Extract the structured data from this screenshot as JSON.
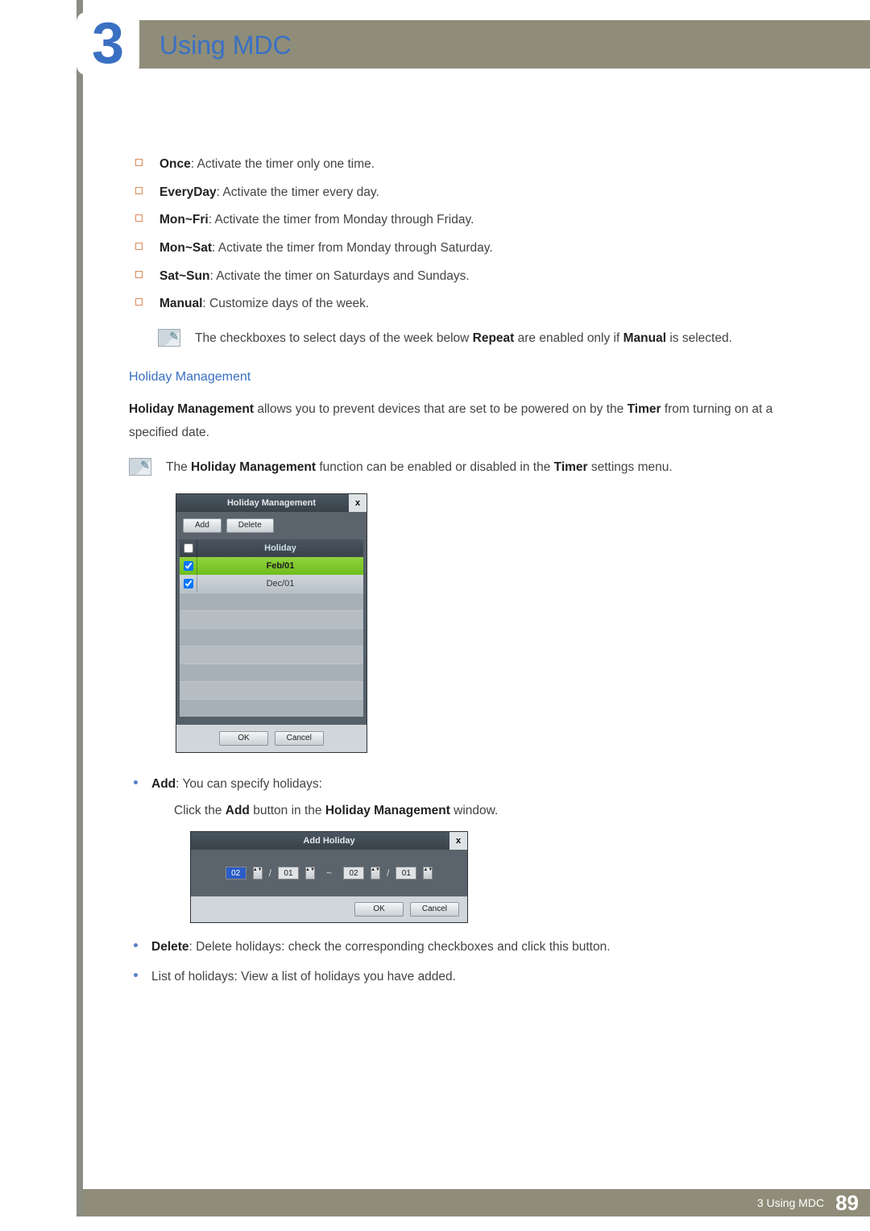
{
  "chapter": {
    "number": "3",
    "title": "Using MDC"
  },
  "timer_options": [
    {
      "name": "Once",
      "desc": ": Activate the timer only one time."
    },
    {
      "name": "EveryDay",
      "desc": ": Activate the timer every day."
    },
    {
      "name": "Mon~Fri",
      "desc": ": Activate the timer from Monday through Friday."
    },
    {
      "name": "Mon~Sat",
      "desc": ": Activate the timer from Monday through Saturday."
    },
    {
      "name": "Sat~Sun",
      "desc": ": Activate the timer on Saturdays and Sundays."
    },
    {
      "name": "Manual",
      "desc": ": Customize days of the week."
    }
  ],
  "note1": {
    "pre": "The checkboxes to select days of the week below ",
    "b1": "Repeat",
    "mid": " are enabled only if ",
    "b2": "Manual",
    "post": " is selected."
  },
  "holiday": {
    "heading": "Holiday Management",
    "p1": {
      "b": "Holiday Management",
      "mid": " allows you to prevent devices that are set to be powered on by the ",
      "b2": "Timer",
      "post": " from turning on at a specified date."
    },
    "note": {
      "pre": "The ",
      "b": "Holiday Management",
      "mid": " function can be enabled or disabled in the ",
      "b2": "Timer",
      "post": " settings menu."
    }
  },
  "hm_dialog": {
    "title": "Holiday Management",
    "close": "x",
    "add": "Add",
    "delete": "Delete",
    "col": "Holiday",
    "rows": [
      {
        "label": "Feb/01",
        "checked": true,
        "hl": true
      },
      {
        "label": "Dec/01",
        "checked": true,
        "hl": false
      }
    ],
    "ok": "OK",
    "cancel": "Cancel"
  },
  "add_section": {
    "b": "Add",
    "desc": ": You can specify holidays:",
    "line2_pre": "Click the ",
    "line2_b1": "Add",
    "line2_mid": " button in the ",
    "line2_b2": "Holiday Management",
    "line2_post": " window."
  },
  "ah_dialog": {
    "title": "Add Holiday",
    "close": "x",
    "start_m": "02",
    "start_d": "01",
    "end_m": "02",
    "end_d": "01",
    "tilde": "~",
    "slash": "/",
    "ok": "OK",
    "cancel": "Cancel"
  },
  "delete_item": {
    "b": "Delete",
    "desc": ": Delete holidays: check the corresponding checkboxes and click this button."
  },
  "list_item": "List of holidays: View a list of holidays you have added.",
  "footer": {
    "label": "3 Using MDC",
    "page": "89"
  }
}
